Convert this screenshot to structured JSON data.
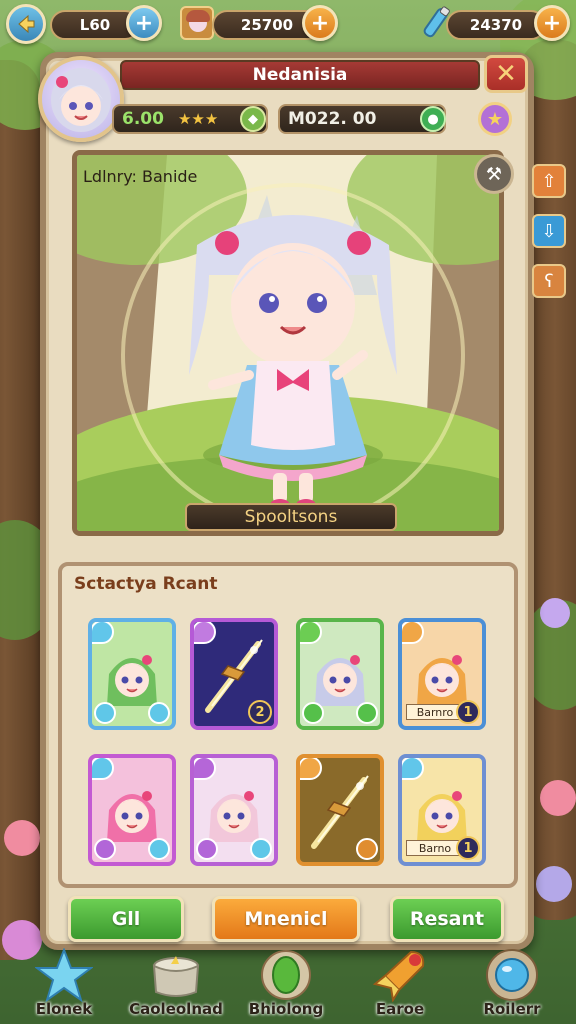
{
  "topbar": {
    "level": "L60",
    "gold": "25700",
    "gems": "24370"
  },
  "panel": {
    "title": "Nedanisia",
    "power": "6.00",
    "currency": "M022. 00",
    "showcase_label": "Ldlnry: Banide",
    "showcase_button": "Spooltsons"
  },
  "collection": {
    "title": "Sctactya Rcant",
    "cards": [
      {
        "frame": "#5fb0e6",
        "bg": "#bfe6a4",
        "hair": "#6fbf5e",
        "kind": "hero",
        "gem_tl": "#61c6ea",
        "gem_l": "#5fc7e8",
        "gem_r": "#5fc7e8"
      },
      {
        "frame": "#b55ad6",
        "bg": "#2f2a7a",
        "kind": "weapon",
        "rank": "2",
        "gem_tl": "#c17be0"
      },
      {
        "frame": "#59b54a",
        "bg": "#cfe9c0",
        "hair": "#c7cbe9",
        "kind": "hero",
        "gem_tl": "#6ccd53",
        "gem_l": "#55c04a",
        "gem_r": "#55c04a"
      },
      {
        "frame": "#4b8fd6",
        "bg": "#f7d6a8",
        "hair": "#f0a646",
        "kind": "hero",
        "name": "Barnro",
        "rank": "1",
        "gem_tl": "#f0a646"
      },
      {
        "frame": "#c35ad2",
        "bg": "#f4c1dc",
        "hair": "#f070a8",
        "kind": "hero",
        "gem_tl": "#61c6ea",
        "gem_l": "#b266d8",
        "gem_r": "#5fc7e8"
      },
      {
        "frame": "#b760d4",
        "bg": "#f3dff0",
        "hair": "#f2c7da",
        "kind": "hero",
        "gem_tl": "#b566d8",
        "gem_l": "#b266d8",
        "gem_r": "#5fc7e8"
      },
      {
        "frame": "#e0902f",
        "bg": "#8a6a2a",
        "kind": "weapon",
        "gem_tl": "#f0a646",
        "gem_r": "#e08d2f"
      },
      {
        "frame": "#6e8fd2",
        "bg": "#f7e4a8",
        "hair": "#f2d15c",
        "kind": "hero",
        "name": "Barno",
        "rank": "1",
        "gem_tl": "#61c6ea"
      }
    ]
  },
  "actions": {
    "left": "Gll",
    "middle": "Mnenicl",
    "right": "Resant"
  },
  "nav": [
    {
      "label": "Elonek",
      "icon": "star-crystal-icon"
    },
    {
      "label": "Caoleolnad",
      "icon": "treasure-pot-icon"
    },
    {
      "label": "Bhiolong",
      "icon": "green-egg-icon"
    },
    {
      "label": "Earoe",
      "icon": "rocket-icon"
    },
    {
      "label": "Roilerr",
      "icon": "blue-orb-icon"
    }
  ],
  "colors": {
    "title_red": "#a63a35",
    "btn_green": "#4caf3d",
    "btn_orange": "#f08a1c",
    "panel_bg": "#e9dcc0"
  }
}
